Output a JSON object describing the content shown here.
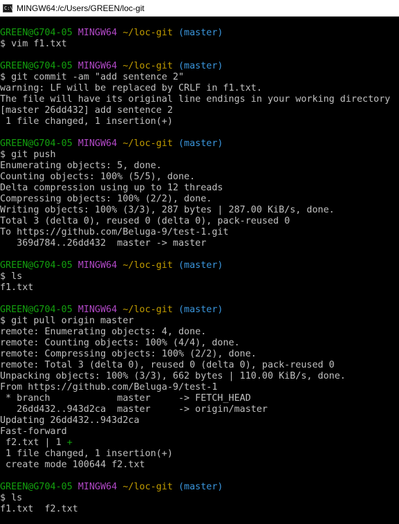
{
  "window": {
    "title": "MINGW64:/c/Users/GREEN/loc-git",
    "icon": "terminal-icon"
  },
  "prompt": {
    "user_host": "GREEN@G704-05",
    "system": "MINGW64",
    "path": "~/loc-git",
    "branch": "(master)",
    "symbol": "$"
  },
  "colors": {
    "background": "#000000",
    "text": "#c0c0c0",
    "user_host": "#13a10e",
    "system": "#b148c6",
    "path": "#c19c00",
    "branch": "#3a96dd"
  },
  "blocks": [
    {
      "command": "vim f1.txt",
      "output": []
    },
    {
      "command": "git commit -am \"add sentence 2\"",
      "output": [
        "warning: LF will be replaced by CRLF in f1.txt.",
        "The file will have its original line endings in your working directory",
        "[master 26dd432] add sentence 2",
        " 1 file changed, 1 insertion(+)"
      ]
    },
    {
      "command": "git push",
      "output": [
        "Enumerating objects: 5, done.",
        "Counting objects: 100% (5/5), done.",
        "Delta compression using up to 12 threads",
        "Compressing objects: 100% (2/2), done.",
        "Writing objects: 100% (3/3), 287 bytes | 287.00 KiB/s, done.",
        "Total 3 (delta 0), reused 0 (delta 0), pack-reused 0",
        "To https://github.com/Beluga-9/test-1.git",
        "   369d784..26dd432  master -> master"
      ]
    },
    {
      "command": "ls",
      "output": [
        "f1.txt"
      ]
    },
    {
      "command": "git pull origin master",
      "output": [
        "remote: Enumerating objects: 4, done.",
        "remote: Counting objects: 100% (4/4), done.",
        "remote: Compressing objects: 100% (2/2), done.",
        "remote: Total 3 (delta 0), reused 0 (delta 0), pack-reused 0",
        "Unpacking objects: 100% (3/3), 662 bytes | 110.00 KiB/s, done.",
        "From https://github.com/Beluga-9/test-1",
        " * branch            master     -> FETCH_HEAD",
        "   26dd432..943d2ca  master     -> origin/master",
        "Updating 26dd432..943d2ca",
        "Fast-forward",
        {
          "text": " f2.txt | 1 ",
          "plus": "+"
        },
        " 1 file changed, 1 insertion(+)",
        " create mode 100644 f2.txt"
      ]
    },
    {
      "command": "ls",
      "output": [
        "f1.txt  f2.txt"
      ]
    }
  ]
}
